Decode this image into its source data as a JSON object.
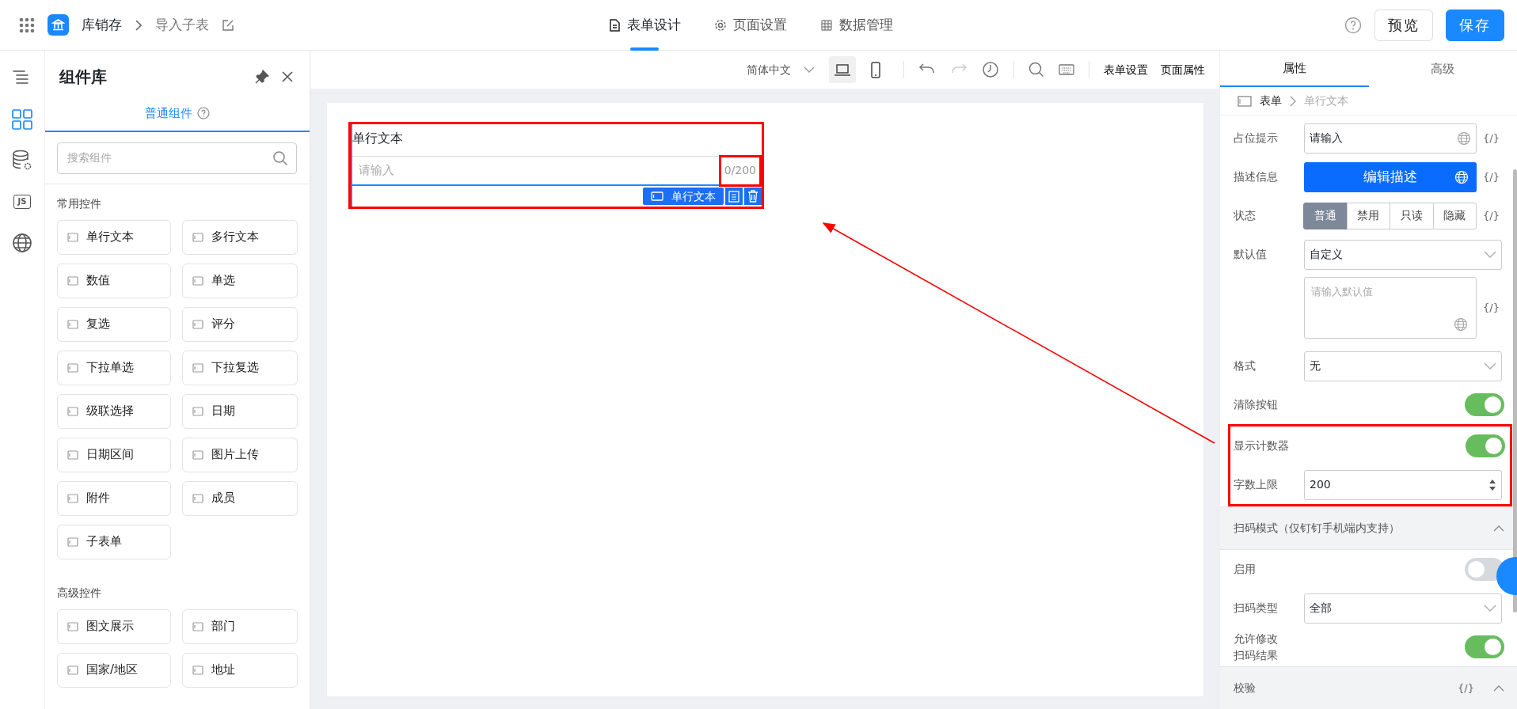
{
  "app": {
    "title": "库销存",
    "page": "导入子表"
  },
  "nav_tabs": [
    {
      "label": "表单设计",
      "selected": true
    },
    {
      "label": "页面设置",
      "selected": false
    },
    {
      "label": "数据管理",
      "selected": false
    }
  ],
  "header_buttons": [
    {
      "label": "预览",
      "kind": "secondary"
    },
    {
      "label": "保存",
      "kind": "primary"
    }
  ],
  "rail": [
    {
      "selected": false
    },
    {
      "selected": true
    },
    {
      "selected": false
    },
    {
      "text": "JS",
      "selected": false
    },
    {
      "selected": false
    }
  ],
  "library": {
    "title": "组件库",
    "tab": "普通组件",
    "search": {
      "placeholder": "搜索组件"
    },
    "groups": [
      {
        "title": "常用控件",
        "items": [
          "单行文本",
          "多行文本",
          "数值",
          "单选",
          "复选",
          "评分",
          "下拉单选",
          "下拉复选",
          "级联选择",
          "日期",
          "日期区间",
          "图片上传",
          "附件",
          "成员",
          "子表单"
        ]
      },
      {
        "title": "高级控件",
        "items": [
          "图文展示",
          "部门",
          "国家/地区",
          "地址"
        ]
      }
    ]
  },
  "toolbar": {
    "language": "简体中文",
    "devices": [
      {
        "selected": true
      },
      {
        "selected": false
      }
    ],
    "links": [
      "表单设置",
      "页面属性"
    ]
  },
  "form": {
    "fields": [
      {
        "label": "单行文本",
        "placeholder": "请输入",
        "counter": "0/200",
        "selected": true,
        "tag": "单行文本",
        "annotated": true
      }
    ]
  },
  "properties": {
    "tabs": [
      {
        "label": "属性",
        "selected": true
      },
      {
        "label": "高级",
        "selected": false
      }
    ],
    "breadcrumb": [
      "表单",
      "单行文本"
    ],
    "rows": [
      {
        "kind": "input",
        "label": "占位提示",
        "value": "请输入",
        "expr": "{/}"
      },
      {
        "kind": "button",
        "label": "描述信息",
        "text": "编辑描述",
        "expr": "{/}"
      },
      {
        "kind": "segmented",
        "label": "状态",
        "options": [
          {
            "label": "普通",
            "selected": true
          },
          {
            "label": "禁用",
            "selected": false
          },
          {
            "label": "只读",
            "selected": false
          },
          {
            "label": "隐藏",
            "selected": false
          }
        ],
        "expr": "{/}"
      },
      {
        "kind": "select",
        "label": "默认值",
        "value": "自定义"
      },
      {
        "kind": "textarea",
        "placeholder": "请输入默认值",
        "expr": "{/}"
      },
      {
        "kind": "select",
        "label": "格式",
        "value": "无"
      },
      {
        "kind": "switch",
        "label": "清除按钮",
        "on": true
      },
      {
        "kind": "switch",
        "label": "显示计数器",
        "on": true,
        "annotated": true
      },
      {
        "kind": "number",
        "label": "字数上限",
        "value": "200",
        "annotated": true
      },
      {
        "kind": "section",
        "title": "扫码模式（仅钉钉手机端内支持）",
        "expanded": true
      },
      {
        "kind": "switch",
        "label": "启用",
        "on": false
      },
      {
        "kind": "select",
        "label": "扫码类型",
        "value": "全部"
      },
      {
        "kind": "switch",
        "label": "允许修改扫码结果",
        "on": true
      },
      {
        "kind": "section",
        "title": "校验",
        "expanded": true,
        "expr": "{/}"
      }
    ]
  }
}
